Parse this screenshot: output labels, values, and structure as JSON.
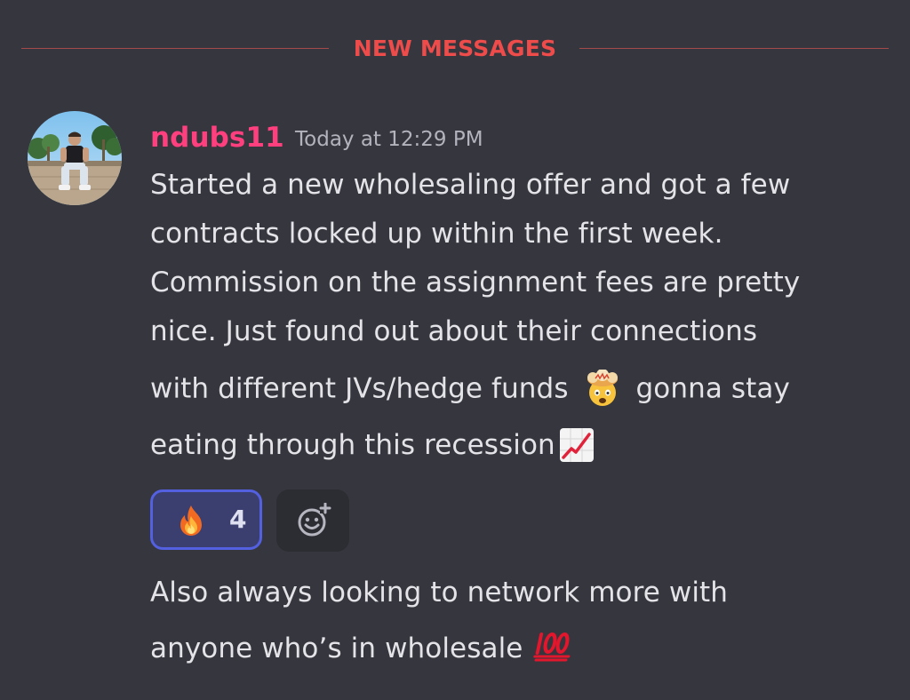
{
  "divider": {
    "label": "NEW MESSAGES",
    "color": "#ee4b4b"
  },
  "message": {
    "username": "ndubs11",
    "username_color": "#ff3f7e",
    "timestamp": "Today at 12:29 PM",
    "avatar": "profile-photo",
    "lines": [
      "Started a new wholesaling offer and got a few",
      "contracts locked up within the first week.",
      "Commission on the assignment fees are pretty",
      "nice. Just found out about their connections"
    ],
    "line5_before": "with different JVs/hedge funds",
    "line5_emoji": "exploding-head-emoji",
    "line5_after": "gonna stay",
    "line6_text": "eating through this recession",
    "line6_emoji": "chart-increasing-emoji"
  },
  "reactions": [
    {
      "emoji": "fire-emoji",
      "count": "4",
      "active": true
    }
  ],
  "add_reaction": {
    "icon": "add-reaction-icon"
  },
  "followup": {
    "line1": "Also always looking to network more with",
    "line2_text": "anyone who’s in wholesale",
    "line2_emoji": "hundred-points-emoji"
  },
  "colors": {
    "background": "#36363e",
    "text": "#e3e3e8",
    "timestamp": "#b3b3bd",
    "reaction_border": "#5360e0",
    "reaction_bg": "#3b3f6f"
  }
}
